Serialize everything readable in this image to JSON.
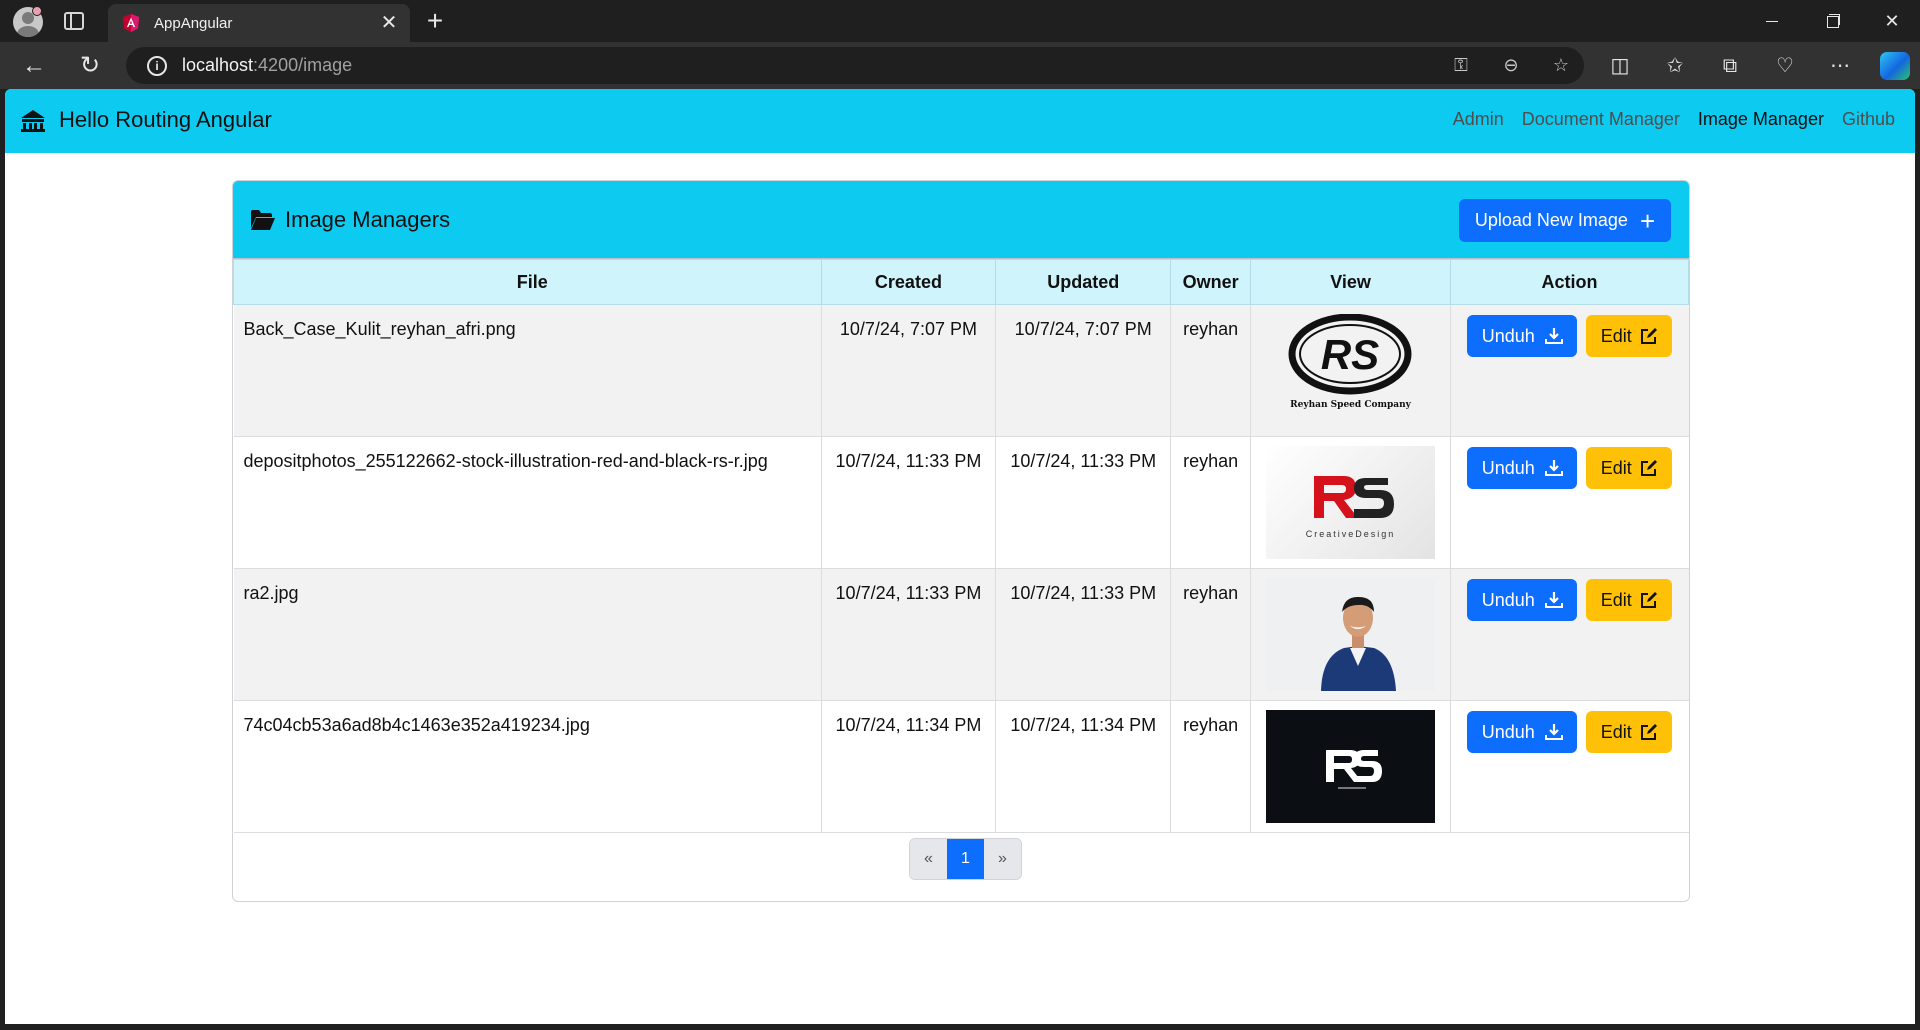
{
  "browser": {
    "tab_title": "AppAngular",
    "url_host": "localhost",
    "url_path": ":4200/image"
  },
  "navbar": {
    "brand": "Hello Routing Angular",
    "links": [
      "Admin",
      "Document Manager",
      "Image Manager",
      "Github"
    ],
    "active_link": "Image Manager"
  },
  "card": {
    "title": "Image Managers",
    "upload_label": "Upload New Image"
  },
  "table": {
    "headers": [
      "File",
      "Created",
      "Updated",
      "Owner",
      "View",
      "Action"
    ],
    "rows": [
      {
        "file": "Back_Case_Kulit_reyhan_afri.png",
        "created": "10/7/24, 7:07 PM",
        "updated": "10/7/24, 7:07 PM",
        "owner": "reyhan",
        "thumb_caption": "Reyhan Speed Company",
        "thumb_sub": ""
      },
      {
        "file": "depositphotos_255122662-stock-illustration-red-and-black-rs-r.jpg",
        "created": "10/7/24, 11:33 PM",
        "updated": "10/7/24, 11:33 PM",
        "owner": "reyhan",
        "thumb_caption": "CreativeDesign",
        "thumb_sub": ""
      },
      {
        "file": "ra2.jpg",
        "created": "10/7/24, 11:33 PM",
        "updated": "10/7/24, 11:33 PM",
        "owner": "reyhan",
        "thumb_caption": "",
        "thumb_sub": ""
      },
      {
        "file": "74c04cb53a6ad8b4c1463e352a419234.jpg",
        "created": "10/7/24, 11:34 PM",
        "updated": "10/7/24, 11:34 PM",
        "owner": "reyhan",
        "thumb_caption": "",
        "thumb_sub": ""
      }
    ],
    "unduh_label": "Unduh",
    "edit_label": "Edit"
  },
  "pagination": {
    "prev": "«",
    "current": "1",
    "next": "»"
  },
  "colors": {
    "navbar": "#0dcaf0",
    "primary": "#0d6efd",
    "warning": "#ffc107",
    "table_header": "#cff4fc"
  }
}
